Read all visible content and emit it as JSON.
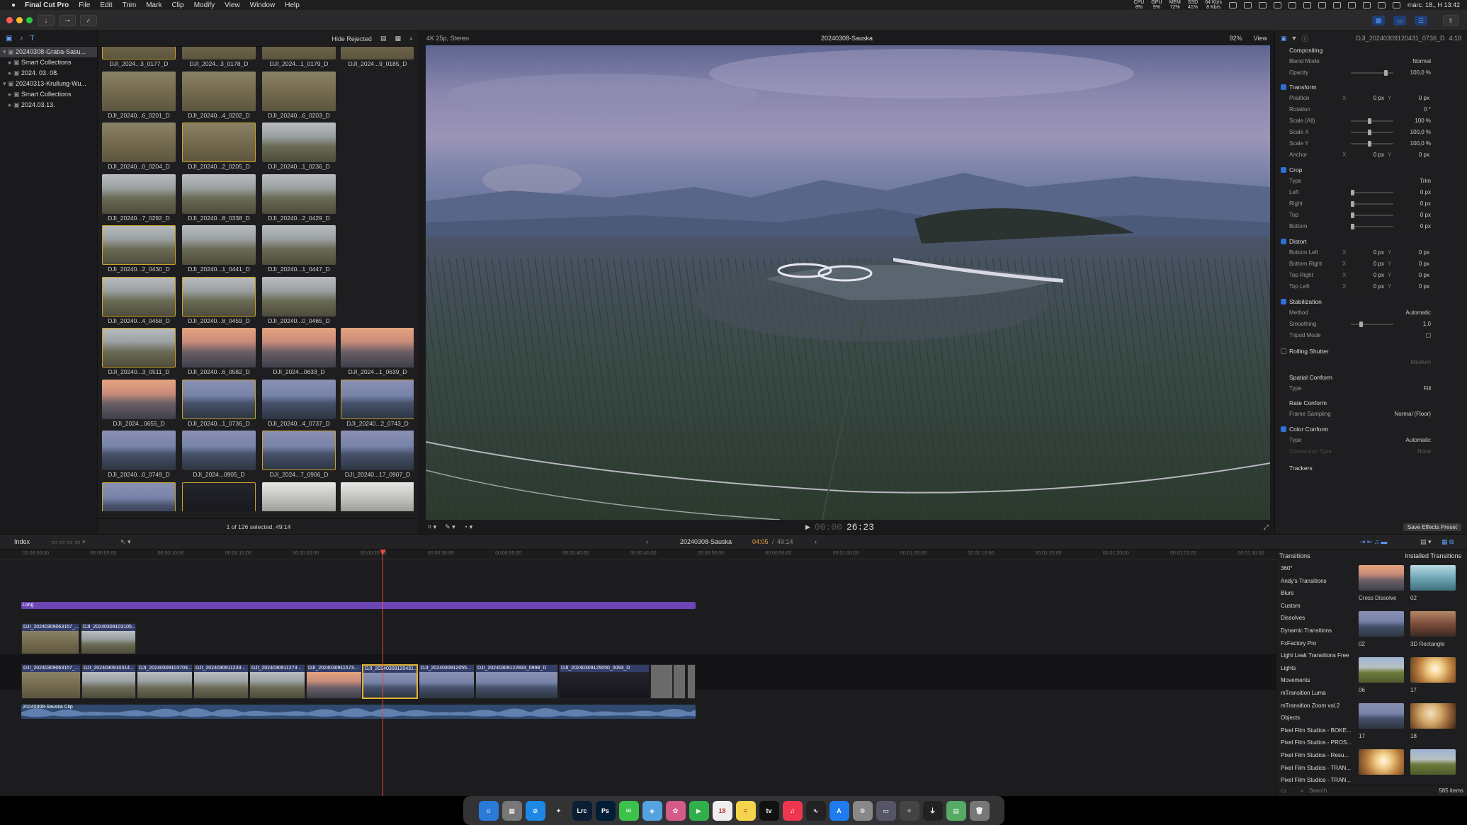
{
  "menubar": {
    "app": "Final Cut Pro",
    "items": [
      "File",
      "Edit",
      "Trim",
      "Mark",
      "Clip",
      "Modify",
      "View",
      "Window",
      "Help"
    ],
    "stats": [
      {
        "value": "8%",
        "label": "CPU"
      },
      {
        "value": "9%",
        "label": "GPU"
      },
      {
        "value": "72%",
        "label": "MEM"
      },
      {
        "value": "41%",
        "label": "SSD"
      }
    ],
    "net_up": "64 Kb/s",
    "net_down": "8 Kb/s",
    "clock": "márc. 18., H 13:42"
  },
  "library": {
    "items": [
      {
        "label": "20240308-Graba-Sasu...",
        "indent": 0,
        "selected": true,
        "open": true
      },
      {
        "label": "Smart Collections",
        "indent": 1
      },
      {
        "label": "2024. 03. 08.",
        "indent": 1
      },
      {
        "label": "20240313-Krullung-Wu...",
        "indent": 0,
        "open": true
      },
      {
        "label": "Smart Collections",
        "indent": 1
      },
      {
        "label": "2024.03.13.",
        "indent": 1
      }
    ]
  },
  "browser": {
    "filter": "Hide Rejected",
    "footer": "1 of 126 selected, 49:14",
    "thumbs": [
      {
        "label": "DJI_2024...3_0177_D",
        "tone": "dry"
      },
      {
        "label": "DJI_2024...3_0178_D",
        "tone": "dry"
      },
      {
        "label": "DJI_2024...1_0179_D",
        "tone": "dry"
      },
      {
        "label": "DJI_2024...9_0185_D",
        "tone": "dry"
      },
      {
        "label": "DJI_20240...6_0201_D",
        "tone": "dry"
      },
      {
        "label": "DJI_20240...4_0202_D",
        "tone": "dry"
      },
      {
        "label": "DJI_20240...6_0203_D",
        "tone": "dry"
      },
      {
        "label": "DJI_20240...0_0204_D",
        "tone": "dry"
      },
      {
        "label": "DJI_20240...2_0205_D",
        "tone": "dry"
      },
      {
        "label": "DJI_20240...1_0236_D",
        "tone": "day"
      },
      {
        "label": "DJI_20240...7_0292_D",
        "tone": "day"
      },
      {
        "label": "DJI_20240...8_0338_D",
        "tone": "day"
      },
      {
        "label": "DJI_20240...2_0429_D",
        "tone": "day"
      },
      {
        "label": "DJI_20240...2_0430_D",
        "tone": "day"
      },
      {
        "label": "DJI_20240...1_0441_D",
        "tone": "day"
      },
      {
        "label": "DJI_20240...1_0447_D",
        "tone": "day"
      },
      {
        "label": "DJI_20240...4_0458_D",
        "tone": "day"
      },
      {
        "label": "DJI_20240...8_0459_D",
        "tone": "day"
      },
      {
        "label": "DJI_20240...0_0465_D",
        "tone": "day"
      },
      {
        "label": "DJI_20240...3_0511_D",
        "tone": "day"
      },
      {
        "label": "DJI_20240...6_0582_D",
        "tone": "dusk"
      },
      {
        "label": "DJI_2024...0633_D",
        "tone": "dusk"
      },
      {
        "label": "DJI_2024...1_0639_D",
        "tone": "dusk"
      },
      {
        "label": "DJI_2024...0655_D",
        "tone": "dusk"
      },
      {
        "label": "DJI_20240...1_0736_D",
        "tone": "blue"
      },
      {
        "label": "DJI_20240...4_0737_D",
        "tone": "blue"
      },
      {
        "label": "DJI_20240...2_0743_D",
        "tone": "blue"
      },
      {
        "label": "DJI_20240...0_0749_D",
        "tone": "blue"
      },
      {
        "label": "DJI_2024...0905_D",
        "tone": "blue"
      },
      {
        "label": "DJI_2024...7_0906_D",
        "tone": "blue"
      },
      {
        "label": "DJI_20240...17_0907_D",
        "tone": "blue"
      },
      {
        "label": "",
        "tone": "blue"
      },
      {
        "label": "",
        "tone": "night"
      },
      {
        "label": "",
        "tone": "interior"
      },
      {
        "label": "",
        "tone": "interior"
      }
    ]
  },
  "viewer": {
    "format": "4K 25p, Stereo",
    "title": "20240308-Sauska",
    "zoom": "92%",
    "view": "View",
    "timecode_dim": "00:00",
    "timecode": "26:23"
  },
  "inspector": {
    "clip": "DJI_20240309120431_0736_D",
    "duration": "4:10",
    "compositing": "Compositing",
    "blend_label": "Blend Mode",
    "blend_value": "Normal",
    "opacity_label": "Opacity",
    "opacity_value": "100,0 %",
    "transform": "Transform",
    "position_label": "Position",
    "position_x": "0 px",
    "position_y": "0 px",
    "rotation_label": "Rotation",
    "rotation_value": "0 °",
    "scale_all_label": "Scale (All)",
    "scale_all_value": "100 %",
    "scale_x_label": "Scale X",
    "scale_x_value": "100,0 %",
    "scale_y_label": "Scale Y",
    "scale_y_value": "100,0 %",
    "anchor_label": "Anchor",
    "anchor_x": "0 px",
    "anchor_y": "0 px",
    "crop": "Crop",
    "crop_type_label": "Type",
    "crop_type_value": "Trim",
    "left_label": "Left",
    "left_value": "0 px",
    "right_label": "Right",
    "right_value": "0 px",
    "top_label": "Top",
    "top_value": "0 px",
    "bottom_label": "Bottom",
    "bottom_value": "0 px",
    "distort": "Distort",
    "bl_label": "Bottom Left",
    "bl_x": "0 px",
    "bl_y": "0 px",
    "br_label": "Bottom Right",
    "br_x": "0 px",
    "br_y": "0 px",
    "tr_label": "Top Right",
    "tr_x": "0 px",
    "tr_y": "0 px",
    "tl_label": "Top Left",
    "tl_x": "0 px",
    "tl_y": "0 px",
    "stabilization": "Stabilization",
    "method_label": "Method",
    "method_value": "Automatic",
    "smoothing_label": "Smoothing",
    "smoothing_value": "1,0",
    "tripod_label": "Tripod Mode",
    "rolling": "Rolling Shutter",
    "rolling_value": "Medium",
    "spatial": "Spatial Conform",
    "spatial_type_label": "Type",
    "spatial_type_value": "Fill",
    "rate": "Rate Conform",
    "frame_sampling_label": "Frame Sampling",
    "frame_sampling_value": "Normal (Floor)",
    "color": "Color Conform",
    "color_type_label": "Type",
    "color_type_value": "Automatic",
    "conversion_label": "Conversion Type",
    "conversion_value": "None",
    "trackers": "Trackers",
    "save_preset": "Save Effects Preset"
  },
  "midbar": {
    "index": "Index",
    "project": "20240308-Sauska",
    "position": "04:05",
    "total": "49:14"
  },
  "timeline": {
    "ruler": [
      "00:00:00:00",
      "00:00:05:00",
      "00:00:10:00",
      "00:00:15:00",
      "00:00:20:00",
      "00:00:25:00",
      "00:00:30:00",
      "00:00:35:00",
      "00:00:40:00",
      "00:00:45:00",
      "00:00:50:00",
      "00:00:55:00",
      "00:01:00:00",
      "00:01:05:00",
      "00:01:10:00",
      "00:01:15:00",
      "00:01:20:00",
      "00:01:25:00",
      "00:01:30:00"
    ],
    "title_bar": "Long",
    "connected": [
      "DJI_20240309063157_...",
      "DJI_20240309103105..."
    ],
    "primary": [
      {
        "label": "DJI_20240309063157_...",
        "tone": "dry"
      },
      {
        "label": "DJI_2024030910314...",
        "tone": "day"
      },
      {
        "label": "DJI_20240309103703...",
        "tone": "day"
      },
      {
        "label": "DJI_2024030911233...",
        "tone": "day"
      },
      {
        "label": "DJI_2024030911273...",
        "tone": "day"
      },
      {
        "label": "DJI_2024030911573...",
        "tone": "dusk"
      },
      {
        "label": "DJI_20240309120431...",
        "tone": "blue"
      },
      {
        "label": "DJI_2024030912055...",
        "tone": "blue"
      },
      {
        "label": "DJI_20240309122833_0998_D",
        "tone": "blue"
      },
      {
        "label": "DJI_20240309125050_0093_D",
        "tone": "night"
      }
    ],
    "audio": "20240308-Sauska Clip"
  },
  "transitions": {
    "title": "Transitions",
    "installed": "Installed Transitions",
    "categories": [
      "360°",
      "Andy's Transitions",
      "Blurs",
      "Custom",
      "Dissolves",
      "Dynamic Transitions",
      "FxFactory Pro",
      "Light Leak Transitions Free",
      "Lights",
      "Movements",
      "mTransition Luma",
      "mTransition Zoom vol.2",
      "Objects",
      "Pixel Film Studios - BOKE...",
      "Pixel Film Studios - PROS...",
      "Pixel Film Studios - Resu...",
      "Pixel Film Studios - TRAN...",
      "Pixel Film Studios - TRAN..."
    ],
    "items": [
      {
        "label": "Cross Dissolve",
        "tone": "dusk"
      },
      {
        "label": "02",
        "tone": "teal"
      },
      {
        "label": "02",
        "tone": "blue"
      },
      {
        "label": "3D Rectangle",
        "tone": "room"
      },
      {
        "label": "06",
        "tone": "field"
      },
      {
        "label": "17",
        "tone": "flare"
      },
      {
        "label": "17",
        "tone": "blue"
      },
      {
        "label": "18",
        "tone": "flare2"
      },
      {
        "label": "",
        "tone": "flare"
      },
      {
        "label": "",
        "tone": "field"
      }
    ],
    "search": "Search",
    "count": "585 items"
  },
  "dock": {
    "apps": [
      {
        "name": "finder",
        "glyph": "☺",
        "color": "#2a7bd8"
      },
      {
        "name": "launchpad",
        "glyph": "▦",
        "color": "#777"
      },
      {
        "name": "safari",
        "glyph": "⊘",
        "color": "#1e88e5"
      },
      {
        "name": "final-cut-pro",
        "glyph": "✦",
        "color": "#333"
      },
      {
        "name": "lightroom-classic",
        "glyph": "Lrc",
        "color": "#0b1e33"
      },
      {
        "name": "photoshop",
        "glyph": "Ps",
        "color": "#001e36"
      },
      {
        "name": "messages",
        "glyph": "✉",
        "color": "#3bc24b"
      },
      {
        "name": "maps",
        "glyph": "◈",
        "color": "#55a2e0"
      },
      {
        "name": "photos",
        "glyph": "✿",
        "color": "#d45a8a"
      },
      {
        "name": "facetime",
        "glyph": "▶",
        "color": "#30b04a"
      },
      {
        "name": "calendar",
        "glyph": "18",
        "color": "#eeeeee"
      },
      {
        "name": "notes",
        "glyph": "≡",
        "color": "#f4d44a"
      },
      {
        "name": "apple-tv",
        "glyph": "tv",
        "color": "#111"
      },
      {
        "name": "music",
        "glyph": "♫",
        "color": "#f0364f"
      },
      {
        "name": "voice-memos",
        "glyph": "∿",
        "color": "#222"
      },
      {
        "name": "app-store",
        "glyph": "A",
        "color": "#1e7cf0"
      },
      {
        "name": "system-settings",
        "glyph": "⚙",
        "color": "#888"
      },
      {
        "name": "screen",
        "glyph": "▭",
        "color": "#556"
      },
      {
        "name": "compressor",
        "glyph": "✧",
        "color": "#444"
      },
      {
        "name": "activity-monitor",
        "glyph": "⏚",
        "color": "#222"
      },
      {
        "name": "folder-stack",
        "glyph": "▤",
        "color": "#5a6"
      },
      {
        "name": "trash",
        "glyph": "🗑",
        "color": "#777"
      }
    ]
  }
}
